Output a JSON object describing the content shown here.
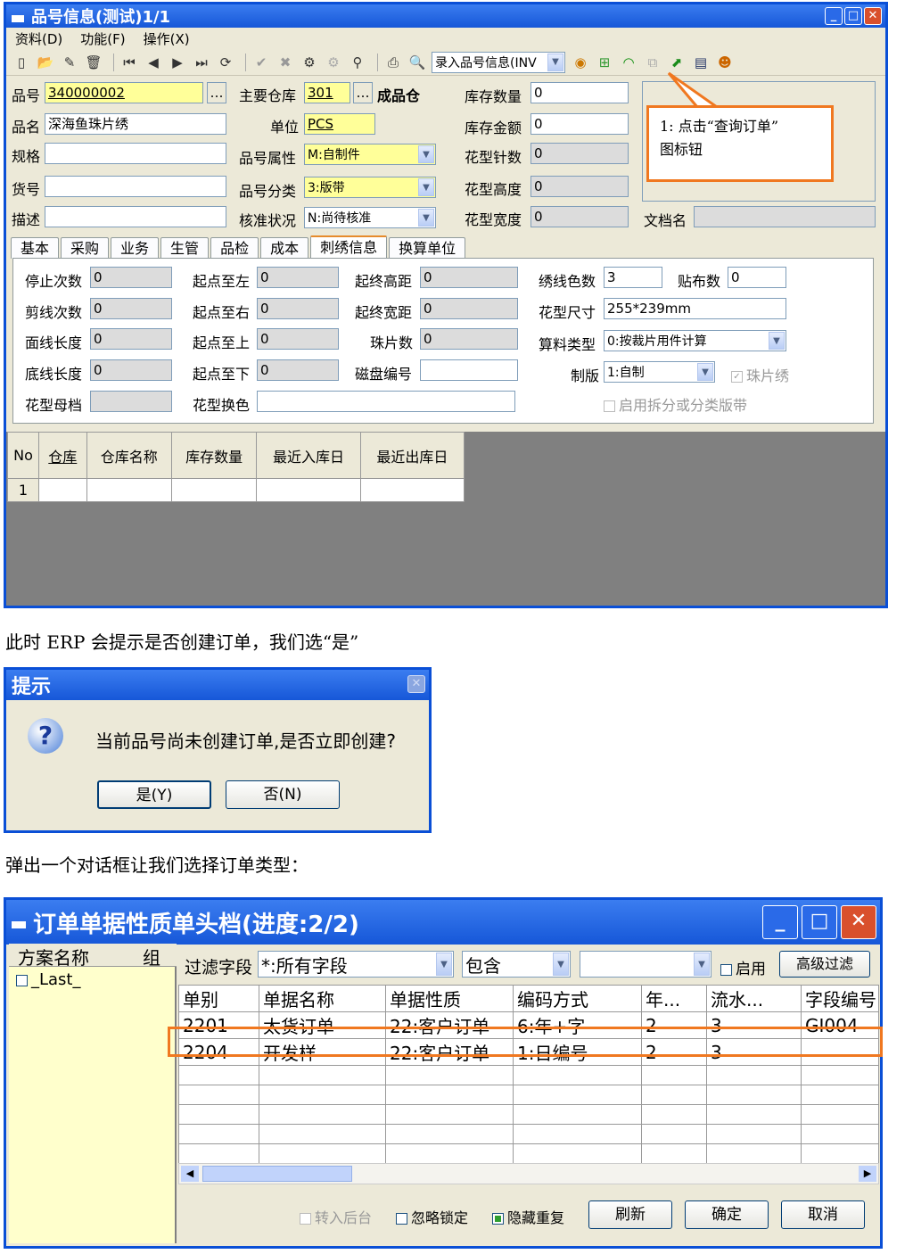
{
  "win1": {
    "title": "品号信息(测试)1/1",
    "menu": [
      "资料(D)",
      "功能(F)",
      "操作(X)"
    ],
    "toolbar_combo": "录入品号信息(INV"
  },
  "fields": {
    "pinhao_l": "品号",
    "pinhao": "340000002",
    "pinming_l": "品名",
    "pinming": "深海鱼珠片绣",
    "guige_l": "规格",
    "guige": "",
    "huohao_l": "货号",
    "huohao": "",
    "miaoshu_l": "描述",
    "miaoshu": "",
    "cangku_l": "主要仓库",
    "cangku": "301",
    "cangku_name": "成品仓",
    "danwei_l": "单位",
    "danwei": "PCS",
    "shuxing_l": "品号属性",
    "shuxing": "M:自制件",
    "fenlei_l": "品号分类",
    "fenlei": "3:版带",
    "hezhun_l": "核准状况",
    "hezhun": "N:尚待核准",
    "kucun_l": "库存数量",
    "kucun": "0",
    "jine_l": "库存金额",
    "jine": "0",
    "zhenshu_l": "花型针数",
    "zhenshu": "0",
    "gaodu_l": "花型高度",
    "gaodu": "0",
    "kuandu_l": "花型宽度",
    "kuandu": "0",
    "wendang_l": "文档名",
    "wendang": ""
  },
  "callout": {
    "line1": "1: 点击“查询订单”",
    "line2": "图标钮"
  },
  "tabs": [
    "基本",
    "采购",
    "业务",
    "生管",
    "品检",
    "成本",
    "刺绣信息",
    "换算单位"
  ],
  "emb": {
    "c1": [
      {
        "l": "停止次数",
        "v": "0"
      },
      {
        "l": "剪线次数",
        "v": "0"
      },
      {
        "l": "面线长度",
        "v": "0"
      },
      {
        "l": "底线长度",
        "v": "0"
      },
      {
        "l": "花型母档",
        "v": ""
      }
    ],
    "c2": [
      {
        "l": "起点至左",
        "v": "0"
      },
      {
        "l": "起点至右",
        "v": "0"
      },
      {
        "l": "起点至上",
        "v": "0"
      },
      {
        "l": "起点至下",
        "v": "0"
      },
      {
        "l": "花型换色",
        "v": ""
      }
    ],
    "c3": [
      {
        "l": "起终高距",
        "v": "0"
      },
      {
        "l": "起终宽距",
        "v": "0"
      },
      {
        "l": "珠片数",
        "v": "0"
      },
      {
        "l": "磁盘编号",
        "v": ""
      }
    ],
    "xiuxian_l": "绣线色数",
    "xiuxian": "3",
    "tiebu_l": "贴布数",
    "tiebu": "0",
    "chicun_l": "花型尺寸",
    "chicun": "255*239mm",
    "suanliao_l": "算料类型",
    "suanliao": "0:按裁片用件计算",
    "zhiban_l": "制版",
    "zhiban": "1:自制",
    "zhupian": "珠片绣",
    "chaifen": "启用拆分或分类版带"
  },
  "grid1": {
    "headers": [
      "No",
      "仓库",
      "仓库名称",
      "库存数量",
      "最近入库日",
      "最近出库日"
    ],
    "row": "1"
  },
  "text1": "此时 ERP 会提示是否创建订单，我们选“是”",
  "dlg": {
    "title": "提示",
    "msg": "当前品号尚未创建订单,是否立即创建?",
    "yes": "是(Y)",
    "no": "否(N)"
  },
  "text2": "弹出一个对话框让我们选择订单类型：",
  "win2": {
    "title": "订单单据性质单头档(进度:2/2)",
    "left_headers": [
      "方案名称",
      "组"
    ],
    "left_item": "_Last_",
    "filter_label": "过滤字段",
    "filter_field": "*:所有字段",
    "filter_op": "包含",
    "filter_val": "",
    "enable": "启用",
    "adv": "高级过滤",
    "headers": [
      "单别",
      "单据名称",
      "单据性质",
      "编码方式",
      "年...",
      "流水...",
      "字段编号"
    ],
    "rows": [
      [
        "2201",
        "太货订单",
        "22:客户订单",
        "6:年+字",
        "2",
        "3",
        "GI004"
      ],
      [
        "2204",
        "开发样",
        "22:客户订单",
        "1:日编号",
        "2",
        "3",
        ""
      ]
    ],
    "chk1": "转入后台",
    "chk2": "忽略锁定",
    "chk3": "隐藏重复",
    "btn_refresh": "刷新",
    "btn_ok": "确定",
    "btn_cancel": "取消"
  }
}
